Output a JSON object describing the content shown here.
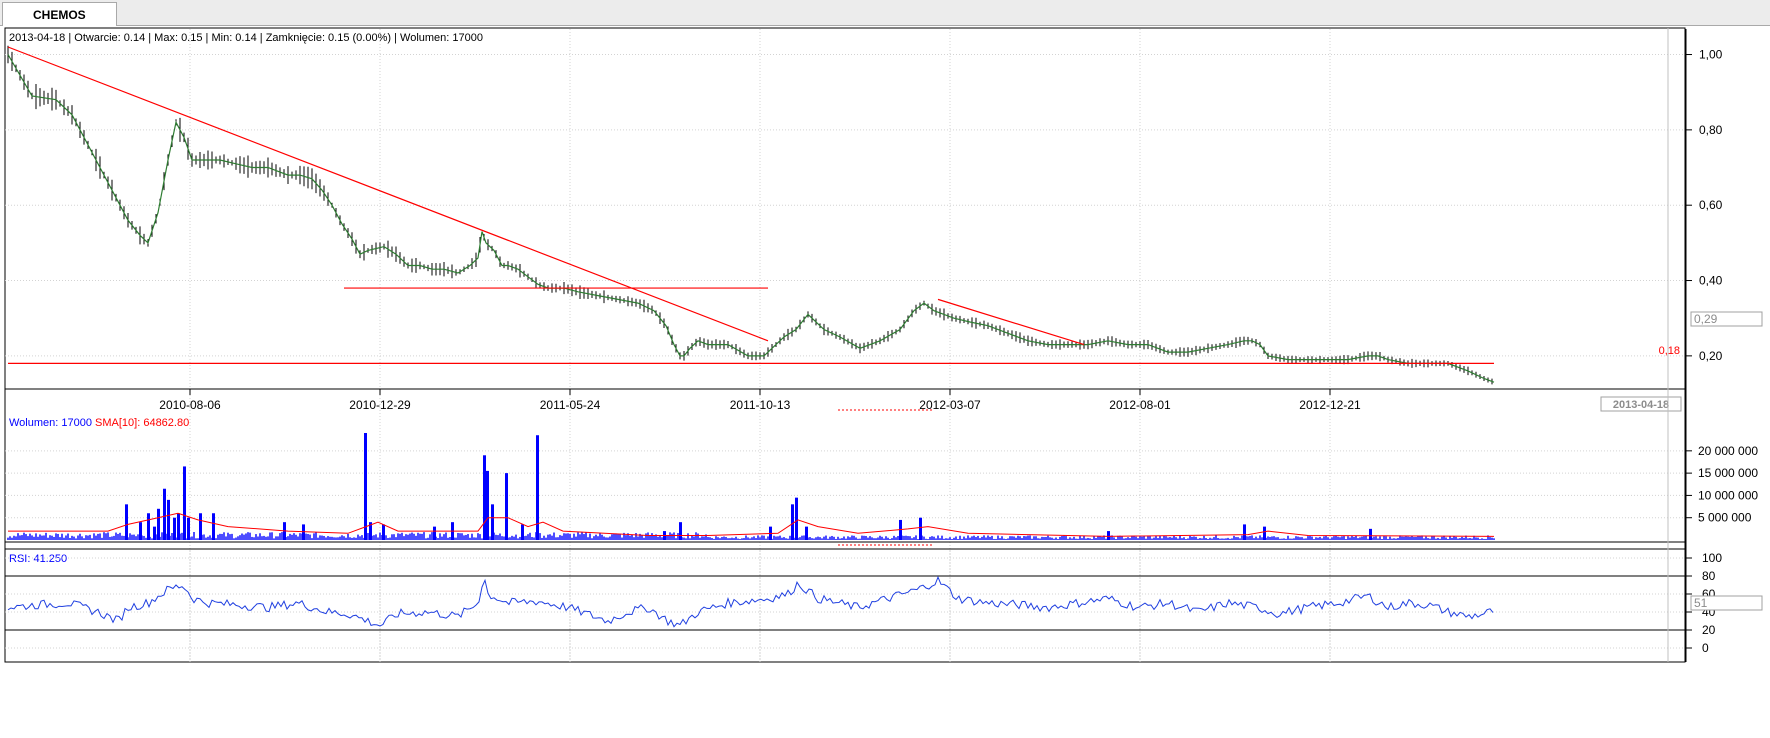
{
  "tab": {
    "label": "CHEMOS"
  },
  "colors": {
    "grid": "#d3d3d3",
    "price_line": "#2e7d32",
    "candle": "#000000",
    "trendline": "#ff0000",
    "volume": "#0000ff",
    "sma": "#ff0000",
    "rsi": "#1f3fe0",
    "text_blue": "#0000ff",
    "text_red": "#ff0000"
  },
  "chart_data": [
    {
      "type": "line",
      "subtype": "ohlc",
      "info": {
        "date": "2013-04-18",
        "open": "Otwarcie: 0.14",
        "max": "Max: 0.15",
        "min": "Min: 0.14",
        "close": "Zamknięcie: 0.15 (0.00%)",
        "volume": "Wolumen: 17000"
      },
      "ylim": [
        0.12,
        1.02
      ],
      "yticks": [
        {
          "v": 1.0,
          "label": "1,00"
        },
        {
          "v": 0.8,
          "label": "0,80"
        },
        {
          "v": 0.6,
          "label": "0,60"
        },
        {
          "v": 0.4,
          "label": "0,40"
        },
        {
          "v": 0.2,
          "label": "0,20"
        }
      ],
      "xticks": [
        "2010-08-06",
        "2010-12-29",
        "2011-05-24",
        "2011-10-13",
        "2012-03-07",
        "2012-08-01",
        "2012-12-21"
      ],
      "last_date_label": "2013-04-18",
      "current_value_label": "0,29",
      "current_value": 0.29,
      "support_level_label": "0,18",
      "support_level": 0.18,
      "x": [
        0,
        24,
        48,
        64,
        80,
        96,
        112,
        120,
        132,
        140,
        150,
        160,
        168,
        176,
        184,
        196,
        212,
        228,
        244,
        260,
        270,
        280,
        292,
        304,
        314,
        324,
        334,
        344,
        352,
        360,
        376,
        388,
        400,
        412,
        424,
        436,
        450,
        462,
        470,
        474,
        478,
        486,
        494,
        500,
        510,
        520,
        530,
        540,
        548,
        556,
        570,
        590,
        610,
        630,
        646,
        658,
        666,
        672,
        676,
        682,
        690,
        700,
        720,
        740,
        756,
        764,
        776,
        788,
        800,
        816,
        832,
        852,
        872,
        892,
        906,
        916,
        926,
        936,
        946,
        962,
        980,
        1000,
        1020,
        1040,
        1060,
        1080,
        1100,
        1120,
        1140,
        1160,
        1180,
        1200,
        1220,
        1236,
        1244,
        1252,
        1260,
        1280,
        1300,
        1320,
        1340,
        1360,
        1370,
        1380,
        1400,
        1420,
        1440,
        1460,
        1476,
        1486
      ],
      "close": [
        1.0,
        0.89,
        0.88,
        0.84,
        0.76,
        0.68,
        0.6,
        0.56,
        0.52,
        0.5,
        0.58,
        0.72,
        0.82,
        0.78,
        0.72,
        0.72,
        0.72,
        0.71,
        0.7,
        0.7,
        0.69,
        0.68,
        0.68,
        0.67,
        0.64,
        0.6,
        0.55,
        0.51,
        0.47,
        0.48,
        0.49,
        0.47,
        0.44,
        0.44,
        0.43,
        0.43,
        0.42,
        0.44,
        0.46,
        0.53,
        0.5,
        0.48,
        0.44,
        0.44,
        0.43,
        0.41,
        0.39,
        0.38,
        0.38,
        0.38,
        0.37,
        0.36,
        0.35,
        0.34,
        0.32,
        0.28,
        0.23,
        0.2,
        0.2,
        0.22,
        0.24,
        0.23,
        0.23,
        0.2,
        0.2,
        0.22,
        0.25,
        0.27,
        0.31,
        0.27,
        0.25,
        0.22,
        0.24,
        0.27,
        0.32,
        0.34,
        0.32,
        0.31,
        0.3,
        0.29,
        0.28,
        0.26,
        0.24,
        0.23,
        0.23,
        0.23,
        0.24,
        0.23,
        0.23,
        0.21,
        0.21,
        0.22,
        0.23,
        0.24,
        0.24,
        0.23,
        0.2,
        0.19,
        0.19,
        0.19,
        0.19,
        0.2,
        0.2,
        0.19,
        0.18,
        0.18,
        0.18,
        0.16,
        0.14,
        0.13
      ],
      "trendlines": [
        {
          "x1": 0,
          "y1": 1.02,
          "x2": 760,
          "y2": 0.24
        },
        {
          "x1": 930,
          "y1": 0.35,
          "x2": 1076,
          "y2": 0.23
        },
        {
          "x1": 336,
          "y1": 0.38,
          "x2": 760,
          "y2": 0.38
        },
        {
          "x1": 0,
          "y1": 0.18,
          "x2": 1486,
          "y2": 0.18
        }
      ]
    },
    {
      "type": "bar",
      "label": "Wolumen: 17000",
      "sma_label": "SMA[10]: 64862.80",
      "ylim": [
        0,
        24000000
      ],
      "yticks": [
        {
          "v": 20000000,
          "label": "20 000 000"
        },
        {
          "v": 15000000,
          "label": "15 000 000"
        },
        {
          "v": 10000000,
          "label": "10 000 000"
        },
        {
          "v": 5000000,
          "label": "5 000 000"
        }
      ],
      "spikes": [
        {
          "x": 118,
          "v": 8000000
        },
        {
          "x": 132,
          "v": 4000000
        },
        {
          "x": 140,
          "v": 6000000
        },
        {
          "x": 146,
          "v": 3000000
        },
        {
          "x": 150,
          "v": 7000000
        },
        {
          "x": 156,
          "v": 11500000
        },
        {
          "x": 160,
          "v": 9000000
        },
        {
          "x": 166,
          "v": 5000000
        },
        {
          "x": 170,
          "v": 6000000
        },
        {
          "x": 176,
          "v": 16500000
        },
        {
          "x": 180,
          "v": 5000000
        },
        {
          "x": 192,
          "v": 6000000
        },
        {
          "x": 205,
          "v": 6000000
        },
        {
          "x": 276,
          "v": 4000000
        },
        {
          "x": 295,
          "v": 3500000
        },
        {
          "x": 357,
          "v": 24000000
        },
        {
          "x": 362,
          "v": 4000000
        },
        {
          "x": 375,
          "v": 3500000
        },
        {
          "x": 426,
          "v": 3000000
        },
        {
          "x": 444,
          "v": 4000000
        },
        {
          "x": 476,
          "v": 19000000
        },
        {
          "x": 479,
          "v": 15500000
        },
        {
          "x": 484,
          "v": 8000000
        },
        {
          "x": 498,
          "v": 15000000
        },
        {
          "x": 514,
          "v": 3500000
        },
        {
          "x": 529,
          "v": 23500000
        },
        {
          "x": 656,
          "v": 2000000
        },
        {
          "x": 672,
          "v": 4000000
        },
        {
          "x": 762,
          "v": 3000000
        },
        {
          "x": 784,
          "v": 8000000
        },
        {
          "x": 788,
          "v": 9500000
        },
        {
          "x": 798,
          "v": 3000000
        },
        {
          "x": 892,
          "v": 4500000
        },
        {
          "x": 912,
          "v": 5000000
        },
        {
          "x": 1100,
          "v": 2000000
        },
        {
          "x": 1236,
          "v": 3500000
        },
        {
          "x": 1256,
          "v": 3000000
        },
        {
          "x": 1362,
          "v": 2500000
        }
      ],
      "sma": [
        {
          "x": 0,
          "v": 2000000
        },
        {
          "x": 100,
          "v": 2000000
        },
        {
          "x": 120,
          "v": 3500000
        },
        {
          "x": 150,
          "v": 5000000
        },
        {
          "x": 170,
          "v": 6000000
        },
        {
          "x": 190,
          "v": 4500000
        },
        {
          "x": 220,
          "v": 3000000
        },
        {
          "x": 280,
          "v": 2000000
        },
        {
          "x": 340,
          "v": 1500000
        },
        {
          "x": 358,
          "v": 3000000
        },
        {
          "x": 370,
          "v": 4000000
        },
        {
          "x": 390,
          "v": 2000000
        },
        {
          "x": 450,
          "v": 2000000
        },
        {
          "x": 470,
          "v": 2000000
        },
        {
          "x": 480,
          "v": 5000000
        },
        {
          "x": 500,
          "v": 5000000
        },
        {
          "x": 520,
          "v": 3000000
        },
        {
          "x": 535,
          "v": 4000000
        },
        {
          "x": 555,
          "v": 2000000
        },
        {
          "x": 640,
          "v": 1000000
        },
        {
          "x": 700,
          "v": 1000000
        },
        {
          "x": 770,
          "v": 1500000
        },
        {
          "x": 790,
          "v": 4500000
        },
        {
          "x": 810,
          "v": 3000000
        },
        {
          "x": 850,
          "v": 1500000
        },
        {
          "x": 900,
          "v": 2500000
        },
        {
          "x": 920,
          "v": 3000000
        },
        {
          "x": 960,
          "v": 1500000
        },
        {
          "x": 1100,
          "v": 800000
        },
        {
          "x": 1240,
          "v": 1200000
        },
        {
          "x": 1260,
          "v": 2000000
        },
        {
          "x": 1300,
          "v": 1000000
        },
        {
          "x": 1486,
          "v": 800000
        }
      ]
    },
    {
      "type": "line",
      "label": "RSI: 41.250",
      "ylim": [
        0,
        100
      ],
      "yticks": [
        {
          "v": 100,
          "label": "100"
        },
        {
          "v": 80,
          "label": "80"
        },
        {
          "v": 60,
          "label": "60"
        },
        {
          "v": 40,
          "label": "40"
        },
        {
          "v": 20,
          "label": "20"
        },
        {
          "v": 0,
          "label": "0"
        }
      ],
      "levels": [
        80,
        20
      ],
      "current_value_label": "51",
      "current_value": 51,
      "x": [
        0,
        30,
        60,
        90,
        110,
        120,
        140,
        160,
        175,
        185,
        200,
        230,
        260,
        290,
        320,
        340,
        360,
        372,
        390,
        420,
        450,
        470,
        476,
        480,
        490,
        500,
        530,
        560,
        600,
        620,
        640,
        660,
        672,
        690,
        720,
        760,
        780,
        790,
        810,
        830,
        850,
        880,
        910,
        930,
        950,
        980,
        1010,
        1040,
        1070,
        1100,
        1130,
        1160,
        1190,
        1220,
        1250,
        1270,
        1300,
        1330,
        1360,
        1380,
        1400,
        1420,
        1440,
        1460,
        1476,
        1486
      ],
      "v": [
        45,
        48,
        50,
        40,
        30,
        45,
        50,
        65,
        70,
        55,
        50,
        48,
        45,
        50,
        40,
        38,
        30,
        25,
        38,
        40,
        35,
        50,
        80,
        60,
        55,
        50,
        52,
        45,
        30,
        40,
        45,
        30,
        25,
        40,
        50,
        55,
        60,
        72,
        55,
        50,
        45,
        55,
        65,
        75,
        55,
        50,
        48,
        45,
        50,
        55,
        45,
        50,
        40,
        50,
        45,
        38,
        45,
        50,
        58,
        45,
        50,
        48,
        40,
        35,
        38,
        41.25
      ]
    }
  ]
}
